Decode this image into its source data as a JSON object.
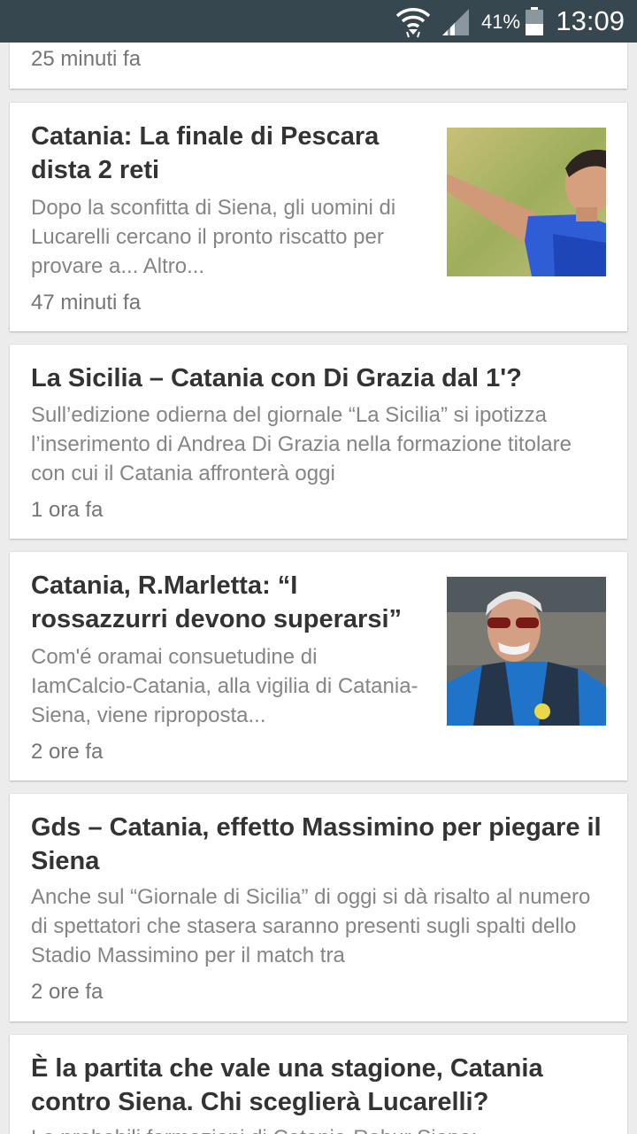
{
  "status_bar": {
    "battery_percent": "41%",
    "time": "13:09",
    "wifi_icon": "wifi-icon",
    "signal_icon": "cell-signal-icon",
    "battery_icon": "battery-icon"
  },
  "colors": {
    "status_bar_bg": "#37474f",
    "feed_bg": "#ececec",
    "title": "#333333",
    "body_text": "#858585"
  },
  "articles": [
    {
      "time": "25 minuti fa"
    },
    {
      "title": "Catania: La finale di Pescara dista 2 reti",
      "summary": "Dopo la sconfitta di Siena, gli uomini di Lucarelli cercano il pronto riscatto per provare a... Altro...",
      "time": "47 minuti fa"
    },
    {
      "title": "La Sicilia – Catania con Di Grazia dal 1'?",
      "summary": "Sull’edizione odierna del giornale “La Sicilia” si ipotizza l’inserimento di Andrea Di Grazia nella formazione titolare con cui il Catania affronterà oggi",
      "time": "1 ora fa"
    },
    {
      "title": "Catania, R.Marletta: “I rossazzurri devono superarsi”",
      "summary": "Com'é oramai consuetudine di IamCalcio-Catania, alla vigilia di Catania-Siena, viene riproposta...",
      "time": "2 ore fa"
    },
    {
      "title": "Gds – Catania, effetto Massimino per piegare il Siena",
      "summary": "Anche sul “Giornale di Sicilia” di oggi si dà risalto al numero di spettatori che stasera saranno presenti sugli spalti dello Stadio Massimino per il match tra",
      "time": "2 ore fa"
    },
    {
      "title": "È la partita che vale una stagione, Catania contro Siena. Chi sceglierà Lucarelli?",
      "summary": "Le probabili formazioni di Catania-Robur Siena:"
    }
  ]
}
